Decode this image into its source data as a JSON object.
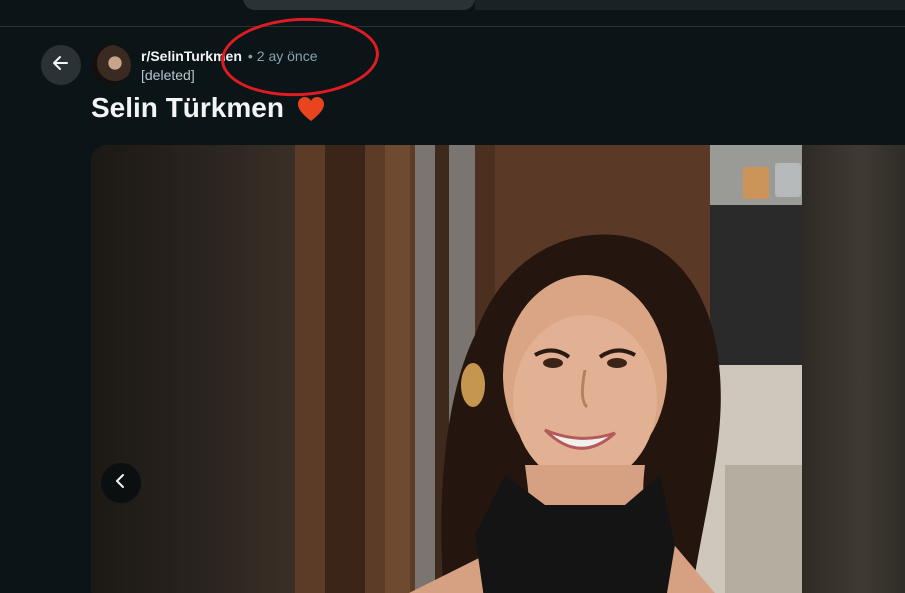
{
  "post": {
    "subreddit": "r/SelinTurkmen",
    "separator": "•",
    "timestamp": "2 ay önce",
    "author": "[deleted]",
    "title": "Selin Türkmen"
  },
  "icons": {
    "back": "arrow-left-icon",
    "heart": "heart-emoji-icon",
    "prev": "chevron-left-icon"
  },
  "colors": {
    "background": "#0b1416",
    "annotation": "#e01b24",
    "heart": "#e8451e",
    "meta_text": "#8ba2ad"
  }
}
